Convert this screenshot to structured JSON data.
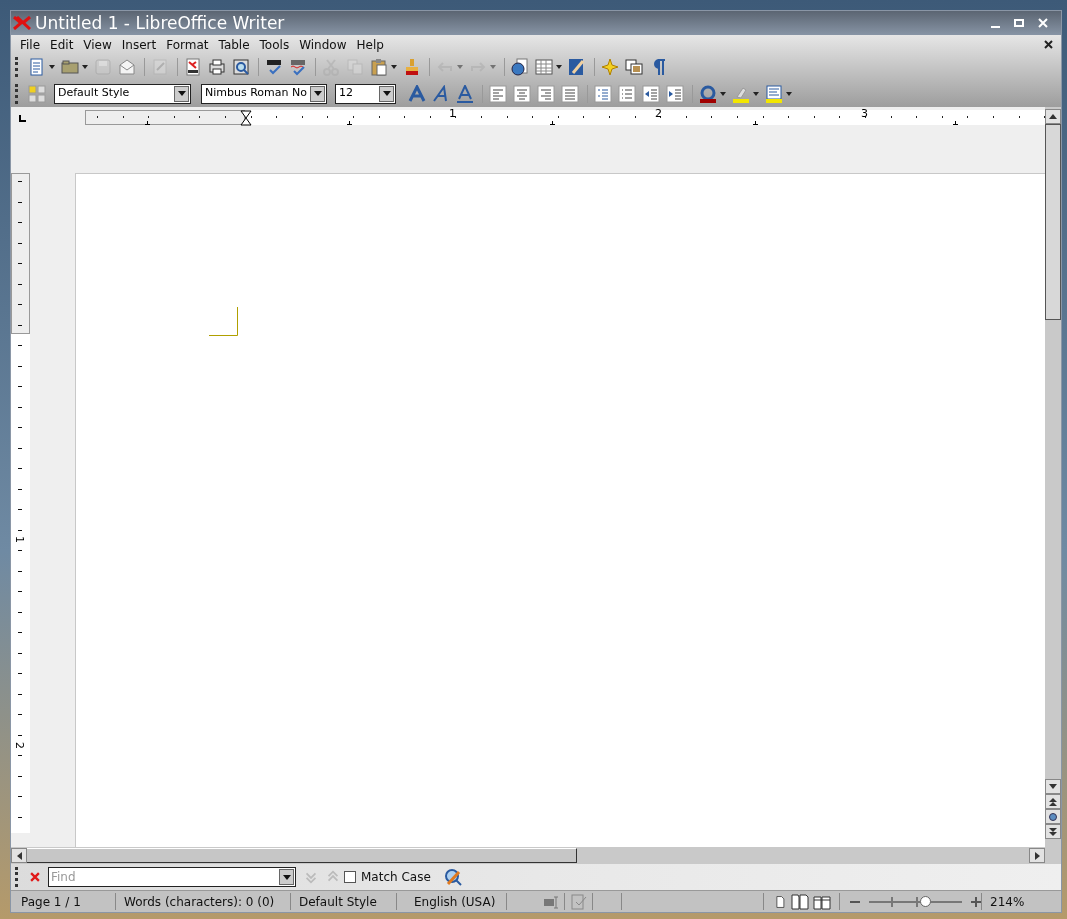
{
  "window": {
    "title": "Untitled 1 - LibreOffice Writer"
  },
  "menu": [
    {
      "label": "File"
    },
    {
      "label": "Edit"
    },
    {
      "label": "View"
    },
    {
      "label": "Insert"
    },
    {
      "label": "Format"
    },
    {
      "label": "Table"
    },
    {
      "label": "Tools"
    },
    {
      "label": "Window"
    },
    {
      "label": "Help"
    }
  ],
  "standard_toolbar": [
    {
      "kind": "new",
      "disabled": false,
      "dropdown": true
    },
    {
      "kind": "open",
      "disabled": false,
      "dropdown": true
    },
    {
      "kind": "save",
      "disabled": true
    },
    {
      "kind": "email",
      "disabled": false
    },
    {
      "kind": "sep"
    },
    {
      "kind": "edit",
      "disabled": true
    },
    {
      "kind": "sep"
    },
    {
      "kind": "pdf",
      "disabled": false
    },
    {
      "kind": "print",
      "disabled": false
    },
    {
      "kind": "preview",
      "disabled": false
    },
    {
      "kind": "sep"
    },
    {
      "kind": "spell",
      "disabled": false
    },
    {
      "kind": "autospell",
      "disabled": false
    },
    {
      "kind": "sep"
    },
    {
      "kind": "cut",
      "disabled": true
    },
    {
      "kind": "copy",
      "disabled": true
    },
    {
      "kind": "paste",
      "disabled": false,
      "dropdown": true
    },
    {
      "kind": "brush",
      "disabled": false
    },
    {
      "kind": "sep"
    },
    {
      "kind": "undo",
      "disabled": true,
      "dropdown": true
    },
    {
      "kind": "redo",
      "disabled": true,
      "dropdown": true
    },
    {
      "kind": "sep"
    },
    {
      "kind": "globe",
      "disabled": false
    },
    {
      "kind": "table",
      "disabled": false,
      "dropdown": true
    },
    {
      "kind": "draw",
      "disabled": false
    },
    {
      "kind": "sep"
    },
    {
      "kind": "star",
      "disabled": false
    },
    {
      "kind": "navigator",
      "disabled": false
    },
    {
      "kind": "pilcrow",
      "disabled": false
    }
  ],
  "formatting_toolbar": {
    "paragraph_style": "Default Style",
    "font_name": "Nimbus Roman No",
    "font_size": "12",
    "buttons": [
      {
        "kind": "bold"
      },
      {
        "kind": "italic"
      },
      {
        "kind": "underline"
      },
      {
        "kind": "sep"
      },
      {
        "kind": "align-left"
      },
      {
        "kind": "align-center"
      },
      {
        "kind": "align-right"
      },
      {
        "kind": "justify"
      },
      {
        "kind": "sep"
      },
      {
        "kind": "numbering"
      },
      {
        "kind": "bullets"
      },
      {
        "kind": "outdent"
      },
      {
        "kind": "indent"
      },
      {
        "kind": "sep"
      },
      {
        "kind": "font-color"
      },
      {
        "kind": "highlight"
      },
      {
        "kind": "background"
      }
    ]
  },
  "horizontal_ruler": {
    "labels": [
      "1",
      "2",
      "3"
    ]
  },
  "vertical_ruler": {
    "labels": [
      "1",
      "2"
    ]
  },
  "find_toolbar": {
    "placeholder": "Find",
    "match_case": {
      "label": "Match Case",
      "checked": false
    }
  },
  "status_bar": {
    "page": "Page 1 / 1",
    "words": "Words (characters): 0 (0)",
    "page_style": "Default Style",
    "language": "English (USA)",
    "zoom": {
      "level": 0.59,
      "reading": "214%"
    }
  }
}
